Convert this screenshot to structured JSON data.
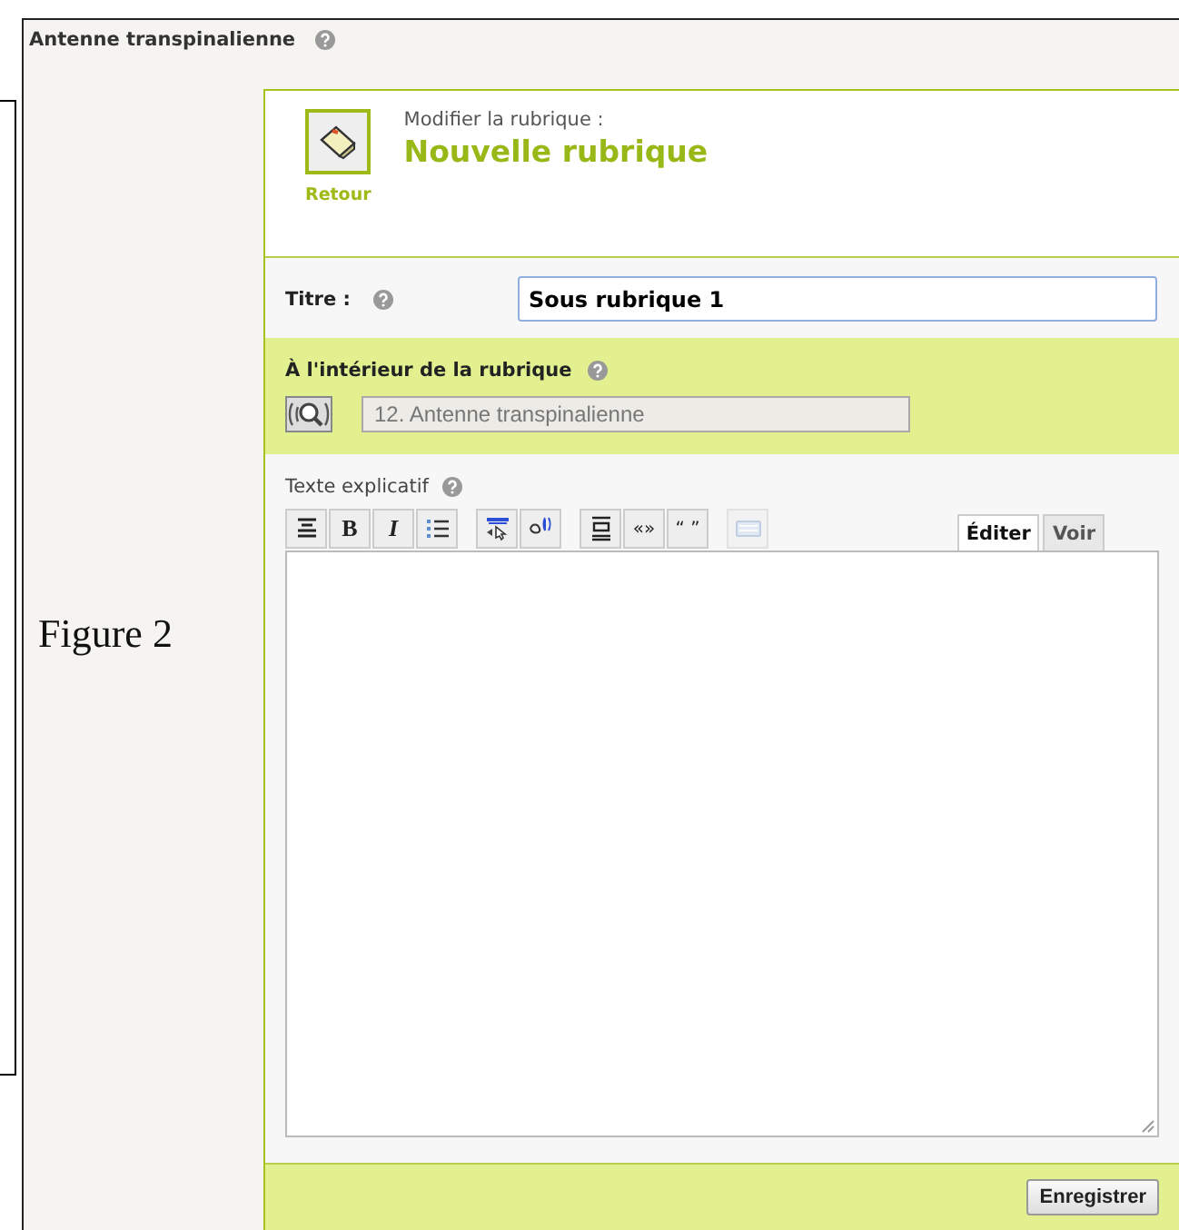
{
  "header": {
    "title": "Antenne transpinalienne"
  },
  "caption": "Figure 2",
  "panel": {
    "back_label": "Retour",
    "subtitle": "Modifier la rubrique :",
    "title": "Nouvelle rubrique"
  },
  "title_field": {
    "label": "Titre :",
    "value": "Sous rubrique 1"
  },
  "parent_field": {
    "label": "À l'intérieur de la rubrique",
    "value": "12. Antenne transpinalienne"
  },
  "text_field": {
    "label": "Texte explicatif",
    "toolbar": [
      [
        {
          "kind": "heading",
          "disabled": false
        },
        {
          "kind": "bold",
          "label": "B",
          "disabled": false
        },
        {
          "kind": "italic",
          "label": "I",
          "disabled": false
        },
        {
          "kind": "list",
          "disabled": false
        }
      ],
      [
        {
          "kind": "link",
          "disabled": false
        },
        {
          "kind": "note",
          "disabled": false
        }
      ],
      [
        {
          "kind": "block",
          "disabled": false
        },
        {
          "kind": "text",
          "label": "«»",
          "disabled": false
        },
        {
          "kind": "text",
          "label": "“ ”",
          "disabled": false
        }
      ],
      [
        {
          "kind": "keyboard",
          "disabled": true
        }
      ]
    ],
    "tabs": [
      {
        "label": "Éditer",
        "selected": true
      },
      {
        "label": "Voir",
        "selected": false
      }
    ]
  },
  "save_button": "Enregistrer"
}
